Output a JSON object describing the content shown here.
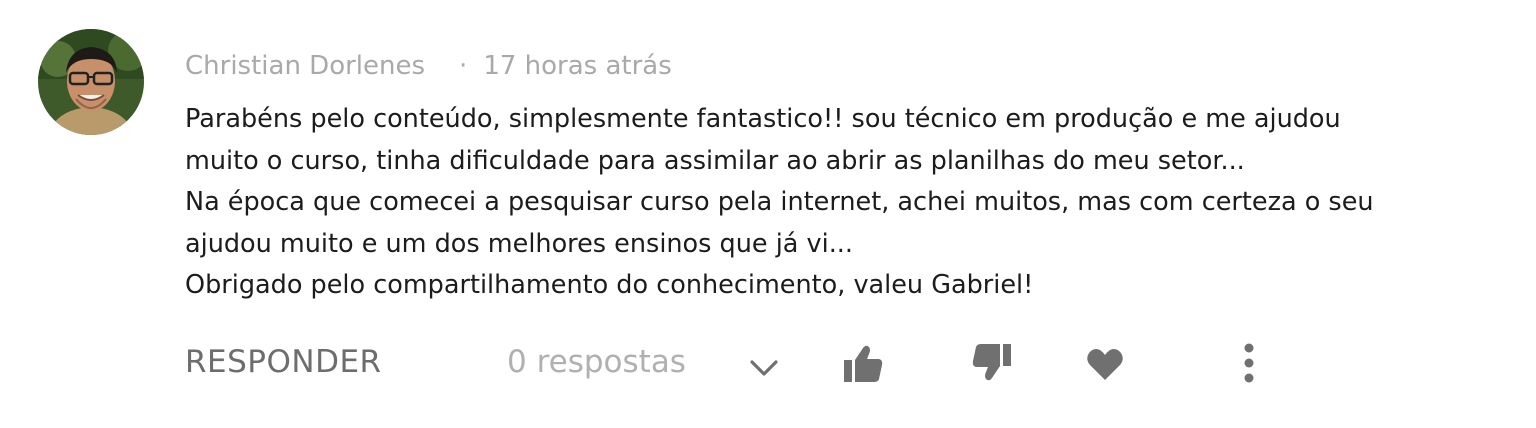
{
  "comment": {
    "author": "Christian Dorlenes",
    "separator": "·",
    "timestamp": "17 horas atrás",
    "body_lines": [
      "Parabéns pelo conteúdo, simplesmente fantastico!! sou técnico em produção e me ajudou",
      "muito o curso, tinha dificuldade para assimilar ao abrir as planilhas do meu setor...",
      "Na época que comecei a pesquisar curso pela internet, achei muitos, mas com certeza o seu",
      "ajudou muito e um dos melhores ensinos que já vi...",
      "Obrigado pelo compartilhamento do conhecimento, valeu Gabriel!"
    ]
  },
  "actions": {
    "reply_label": "RESPONDER",
    "replies_count": "0 respostas",
    "icons": {
      "expand": "chevron-down-icon",
      "like": "thumbs-up-icon",
      "dislike": "thumbs-down-icon",
      "favorite": "heart-icon",
      "more": "more-vertical-icon"
    }
  },
  "colors": {
    "meta_text": "#a9a9a9",
    "body_text": "#1c1c1c",
    "action_text": "#6d6d6d",
    "muted_text": "#b0b0b0",
    "icon": "#707070"
  }
}
